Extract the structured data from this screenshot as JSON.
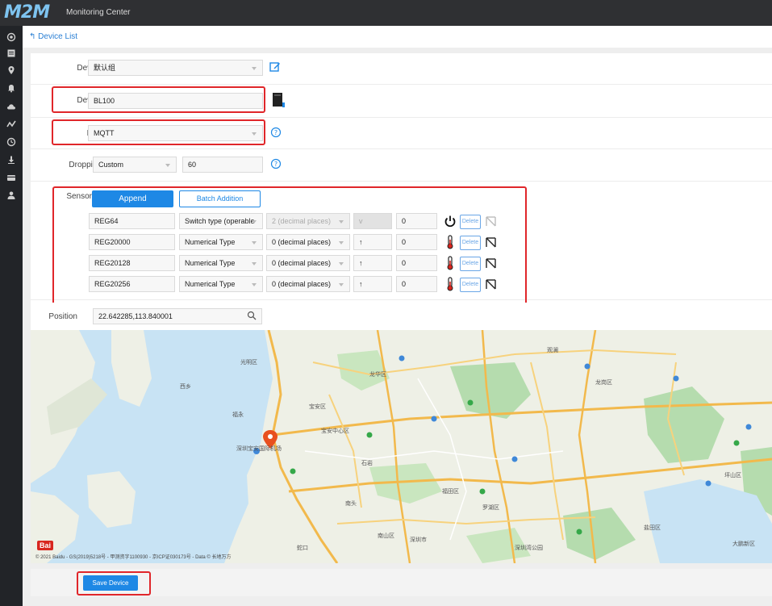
{
  "app": {
    "logo": "M2M",
    "title": "Monitoring Center"
  },
  "breadcrumb": {
    "back_label": "Device List"
  },
  "form": {
    "group": {
      "label": "Device",
      "value": "默认组"
    },
    "device": {
      "label": "Device",
      "value": "BL100"
    },
    "link": {
      "label": "Link",
      "value": "MQTT"
    },
    "dropping": {
      "label": "Dropping",
      "mode": "Custom",
      "value": "60"
    },
    "sensor": {
      "label": "Sensor",
      "append_label": "Append",
      "batch_label": "Batch Addition",
      "rows": [
        {
          "name": "REG64",
          "type": "Switch type (operable",
          "decimals": "2 (decimal places)",
          "extra": "v",
          "value": "0",
          "icon": "power-icon",
          "delete": "Delete",
          "decimals_disabled": true
        },
        {
          "name": "REG20000",
          "type": "Numerical Type",
          "decimals": "0 (decimal places)",
          "extra": "↑",
          "value": "0",
          "icon": "thermometer-icon",
          "delete": "Delete",
          "decimals_disabled": false
        },
        {
          "name": "REG20128",
          "type": "Numerical Type",
          "decimals": "0 (decimal places)",
          "extra": "↑",
          "value": "0",
          "icon": "thermometer-icon",
          "delete": "Delete",
          "decimals_disabled": false
        },
        {
          "name": "REG20256",
          "type": "Numerical Type",
          "decimals": "0 (decimal places)",
          "extra": "↑",
          "value": "0",
          "icon": "thermometer-icon",
          "delete": "Delete",
          "decimals_disabled": false
        }
      ]
    },
    "position": {
      "label": "Position",
      "value": "22.642285,113.840001"
    }
  },
  "map": {
    "copyright": "© 2021 Baidu - GS(2019)5218号 - 甲测资字1100930 - 京ICP证030173号 - Data © 长地万方",
    "baidu_logo": "Bai",
    "labels": [
      "深圳宝安国际机场",
      "福永",
      "西乡",
      "宝安区",
      "南山区",
      "深圳市",
      "龙华区",
      "光明区",
      "龙岗区",
      "福田区",
      "罗湖区",
      "盐田区",
      "坪山区",
      "大鹏新区",
      "南头",
      "蛇口",
      "宝安中心区",
      "深圳湾公园",
      "石岩",
      "观澜"
    ]
  },
  "footer": {
    "save_label": "Save Device"
  },
  "colors": {
    "accent": "#1e88e5",
    "highlight": "#e0262a",
    "topbar": "#2f3033",
    "sidebar": "#222428",
    "logo": "#7ec3ef"
  }
}
